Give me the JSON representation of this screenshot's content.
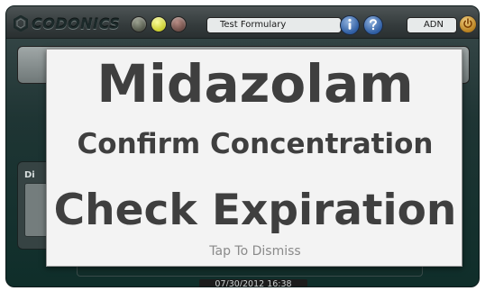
{
  "header": {
    "logo_text": "CODONICS",
    "formulary_label": "Test Formulary",
    "user_label": "ADN",
    "info_icon": "info-icon",
    "help_icon": "help-icon",
    "power_icon": "power-icon"
  },
  "left_panel": {
    "label": "Di"
  },
  "alert": {
    "drug_name": "Midazolam",
    "line_2": "Confirm Concentration",
    "line_3": "Check Expiration",
    "dismiss_hint": "Tap To Dismiss"
  },
  "footer": {
    "datetime": "07/30/2012 16:38"
  },
  "colors": {
    "modal_background": "#f3f3f3",
    "modal_text": "#3f3f3f",
    "screen_background": "#0f2e2a"
  }
}
